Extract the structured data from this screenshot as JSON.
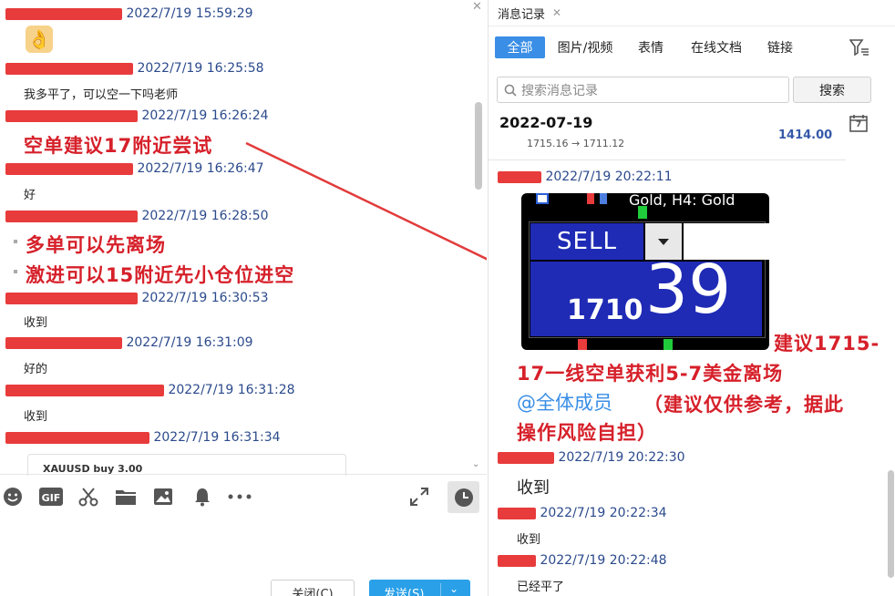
{
  "left": {
    "messages": [
      {
        "time": "2022/7/19 15:59:29"
      },
      {
        "time": "2022/7/19 16:25:58",
        "text": "我多平了，可以空一下吗老师"
      },
      {
        "time": "2022/7/19 16:26:24",
        "text": "空单建议17附近尝试"
      },
      {
        "time": "2022/7/19 16:26:47",
        "text": "好"
      },
      {
        "time": "2022/7/19 16:28:50",
        "lines": [
          "多单可以先离场",
          "激进可以15附近先小仓位进空"
        ]
      },
      {
        "time": "2022/7/19 16:30:53",
        "text": "收到"
      },
      {
        "time": "2022/7/19 16:31:09",
        "text": "好的"
      },
      {
        "time": "2022/7/19 16:31:28",
        "text": "收到"
      },
      {
        "time": "2022/7/19 16:31:34"
      }
    ],
    "card_peek": "XAUUSD  buy 3.00",
    "toolbar": [
      "emoji-icon",
      "gif-icon",
      "scissors-icon",
      "folder-icon",
      "image-icon",
      "bell-icon",
      "more-icon",
      "expand-icon",
      "history-icon"
    ],
    "close_button": "关闭(C)",
    "send_button": "发送(S)"
  },
  "right": {
    "title": "消息记录",
    "tabs": [
      "全部",
      "图片/视频",
      "表情",
      "在线文档",
      "链接"
    ],
    "search_placeholder": "搜索消息记录",
    "search_button": "搜索",
    "date_header": "2022-07-19",
    "price_line": "1715.16 → 1711.12",
    "price_peek": "1414.00",
    "calendar_day": "7",
    "messages": [
      {
        "time": "2022/7/19 20:22:11"
      },
      {
        "time": "2022/7/19 20:22:30",
        "text": "收到"
      },
      {
        "time": "2022/7/19 20:22:34",
        "text": "收到"
      },
      {
        "time": "2022/7/19 20:22:48",
        "text": "已经平了"
      }
    ],
    "trade_card": {
      "header": "Gold, H4:  Gold",
      "sell_label": "SELL",
      "price_small": "1710",
      "price_big": "39"
    },
    "advice_lines": [
      "建议1715-",
      "17一线空单获利5-7美金离场"
    ],
    "mention": "@全体成员",
    "advice_tail": [
      "（建议仅供参考，据此",
      "操作风险自担）"
    ]
  },
  "colors": {
    "accent": "#3a8ee6",
    "red": "#d6202a",
    "blue_text": "#2b4a8c",
    "sell_panel": "#1f2bb5"
  }
}
